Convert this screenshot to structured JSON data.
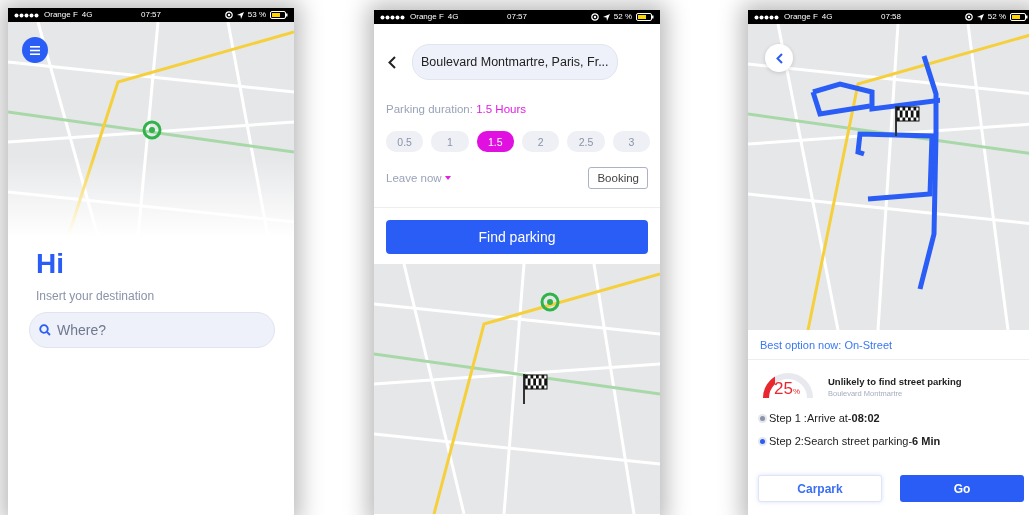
{
  "screens": [
    {
      "kind": "home",
      "status_bar": {
        "carrier": "Orange F",
        "network": "4G",
        "time": "07:57",
        "battery": "53 %"
      },
      "greeting": "Hi",
      "subtitle": "Insert your destination",
      "search": {
        "placeholder": "Where?"
      }
    },
    {
      "kind": "duration",
      "status_bar": {
        "carrier": "Orange F",
        "network": "4G",
        "time": "07:57",
        "battery": "52 %"
      },
      "address": "Boulevard Montmartre, Paris, Fr...",
      "duration_label": "Parking duration:",
      "duration_value": "1.5 Hours",
      "options": [
        {
          "label": "0.5",
          "selected": false
        },
        {
          "label": "1",
          "selected": false
        },
        {
          "label": "1.5",
          "selected": true
        },
        {
          "label": "2",
          "selected": false
        },
        {
          "label": "2.5",
          "selected": false
        },
        {
          "label": "3",
          "selected": false
        }
      ],
      "leave": "Leave now",
      "booking": "Booking",
      "find_button": "Find parking"
    },
    {
      "kind": "result",
      "status_bar": {
        "carrier": "Orange F",
        "network": "4G",
        "time": "07:58",
        "battery": "52 %"
      },
      "best_option": "Best option now: On-Street",
      "probability": {
        "value": "25",
        "unit": "%",
        "level": 0.25
      },
      "headline": "Unlikely to find street parking",
      "place": "Boulevard Montmartre",
      "steps": [
        {
          "text": "Step 1 :Arrive at-**08:02**",
          "active": false
        },
        {
          "text": "Step 2:Search street parking-**6 Min**",
          "active": true
        }
      ],
      "buttons": [
        {
          "label": "Carpark",
          "kind": "secondary"
        },
        {
          "label": "Go",
          "kind": "primary"
        }
      ]
    }
  ]
}
